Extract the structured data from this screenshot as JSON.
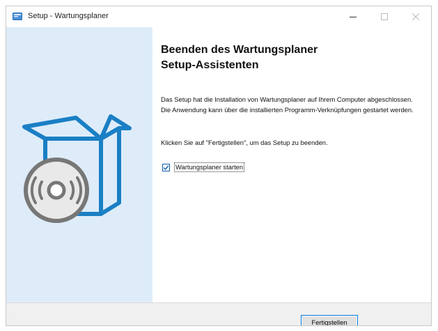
{
  "window": {
    "title": "Setup - Wartungsplaner"
  },
  "icons": {
    "app": "setup-app-icon",
    "minimize": "minimize-icon",
    "maximize": "maximize-icon",
    "close": "close-icon",
    "illustration": "software-box-with-disc-icon"
  },
  "content": {
    "heading": "Beenden des Wartungsplaner\nSetup-Assistenten",
    "paragraph1": "Das Setup hat die Installation von Wartungsplaner auf Ihrem Computer abgeschlossen. Die Anwendung kann über die installierten Programm-Verknüpfungen gestartet werden.",
    "paragraph2": "Klicken Sie auf \"Fertigstellen\", um das Setup zu beenden.",
    "checkbox": {
      "label": "Wartungsplaner starten",
      "checked": true
    }
  },
  "footer": {
    "finish_label_accel": "F",
    "finish_label_rest": "ertigstellen"
  },
  "colors": {
    "sidebar_bg": "#deecf9",
    "accent_blue": "#1a7fc4",
    "disc_gray": "#777777",
    "footer_bg": "#f0f0f0"
  }
}
